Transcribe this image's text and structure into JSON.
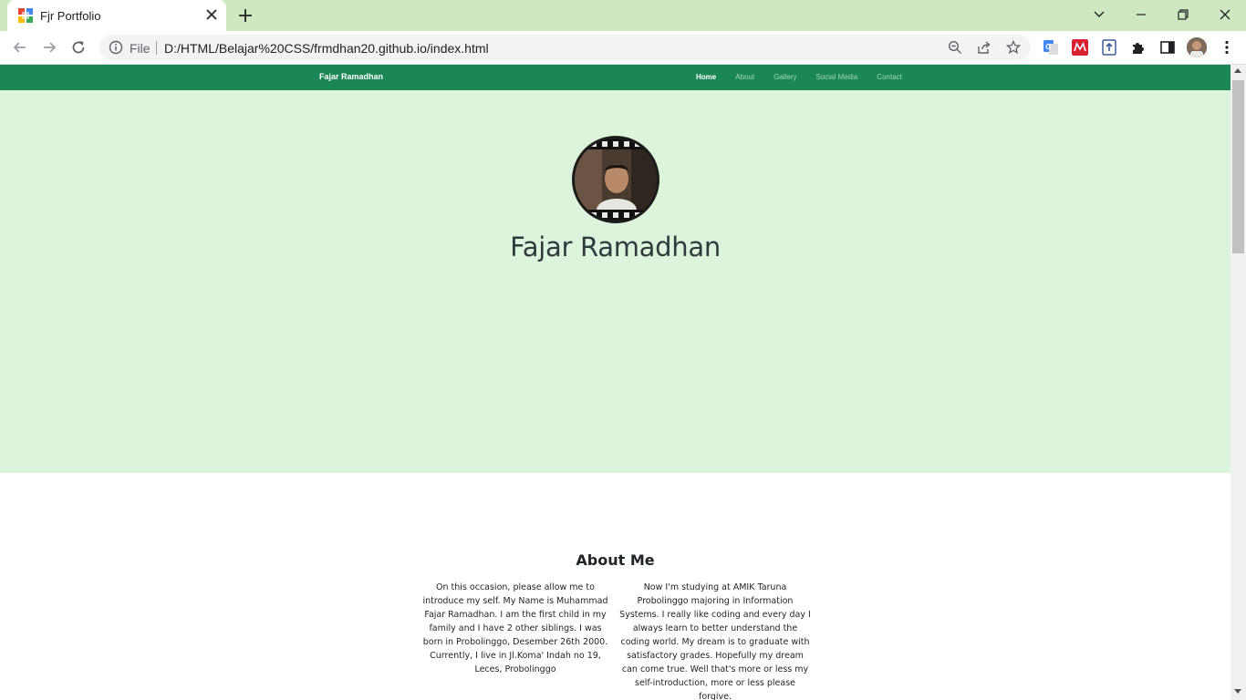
{
  "browser": {
    "tab_title": "Fjr Portfolio",
    "scheme_label": "File",
    "url": "D:/HTML/Belajar%20CSS/frmdhan20.github.io/index.html",
    "theme_color": "#cfe8c1"
  },
  "site": {
    "brand": "Fajar Ramadhan",
    "nav": [
      {
        "label": "Home",
        "active": true
      },
      {
        "label": "About",
        "active": false
      },
      {
        "label": "Gallery",
        "active": false
      },
      {
        "label": "Social Media",
        "active": false
      },
      {
        "label": "Contact",
        "active": false
      }
    ],
    "nav_color": "#1a8754",
    "hero_color": "#dcf3dc",
    "hero_name": "Fajar Ramadhan",
    "about": {
      "title": "About Me",
      "left_text": "On this occasion, please allow me to introduce my self. My Name is Muhammad Fajar Ramadhan. I am the first child in my family and I have 2 other siblings. I was born in Probolinggo, Desember 26th 2000. Currently, I live in Jl.Koma' Indah no 19, Leces, Probolinggo",
      "right_text": "Now I'm studying at AMIK Taruna Probolinggo majoring in Information Systems. I really like coding and every day I always learn to better understand the coding world. My dream is to graduate with satisfactory grades. Hopefully my dream can come true. Well that's more or less my self-introduction, more or less please forgive."
    }
  },
  "icons": {
    "favicon": "google-sites-favicon",
    "tab_close": "close-icon",
    "new_tab": "plus-icon",
    "back": "back-arrow-icon",
    "forward": "forward-arrow-icon",
    "reload": "reload-icon",
    "info": "info-icon",
    "zoom": "zoom-out-icon",
    "share": "share-icon",
    "bookmark": "star-icon",
    "extensions": [
      "google-translate-icon",
      "mendeley-icon",
      "upload-icon",
      "puzzle-icon",
      "side-panel-icon"
    ],
    "menu": "kebab-menu-icon"
  }
}
